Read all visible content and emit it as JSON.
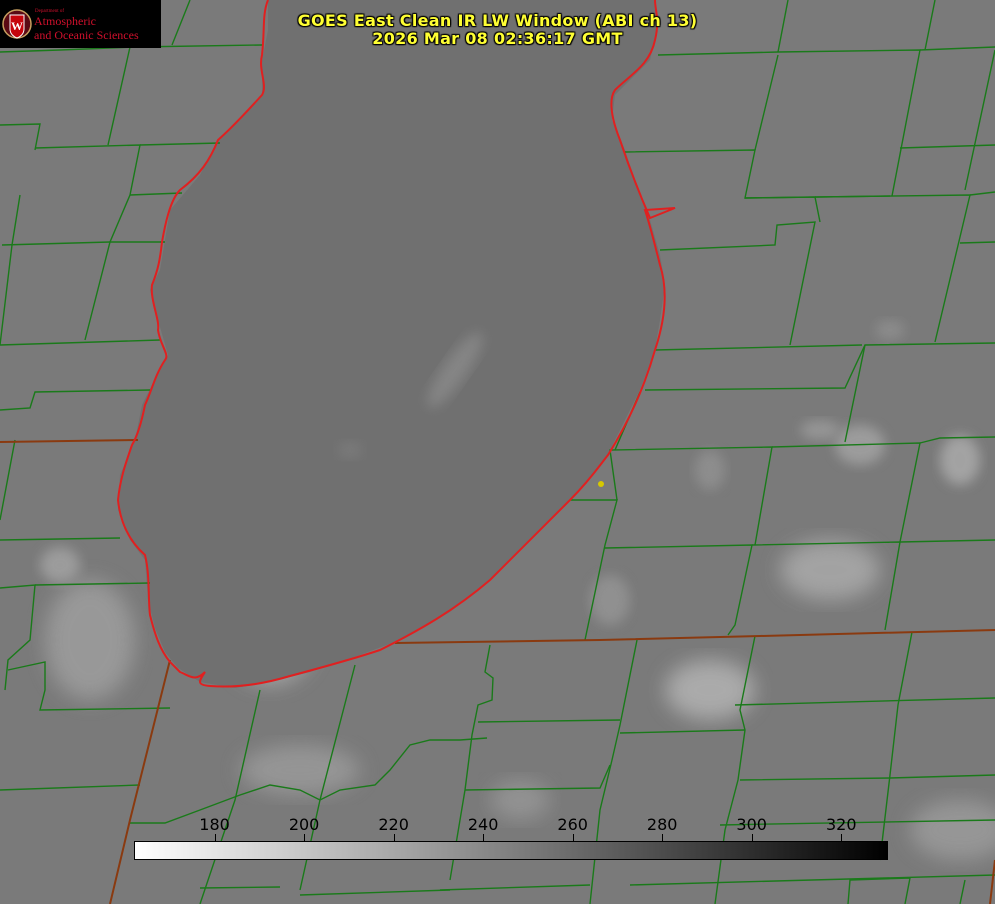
{
  "title": {
    "line1": "GOES East Clean IR LW Window (ABI ch 13)",
    "line2": "2026 Mar 08 02:36:17 GMT"
  },
  "logo": {
    "small": "Department of",
    "line1": "Atmospheric",
    "line2": "and Oceanic Sciences",
    "seal_letter": "W"
  },
  "colorbar": {
    "ticks": [
      "180",
      "200",
      "220",
      "240",
      "260",
      "280",
      "300",
      "320"
    ],
    "min_value": 162,
    "max_value": 330,
    "low_color": "#ffffff",
    "high_color": "#000000"
  },
  "colors": {
    "background": "#7a7a7a",
    "lake": "#6e6e6e",
    "county_lines": "#1a7a1a",
    "state_lines": "#c82020",
    "title": "#ffff33",
    "marker": "#d6c800"
  }
}
